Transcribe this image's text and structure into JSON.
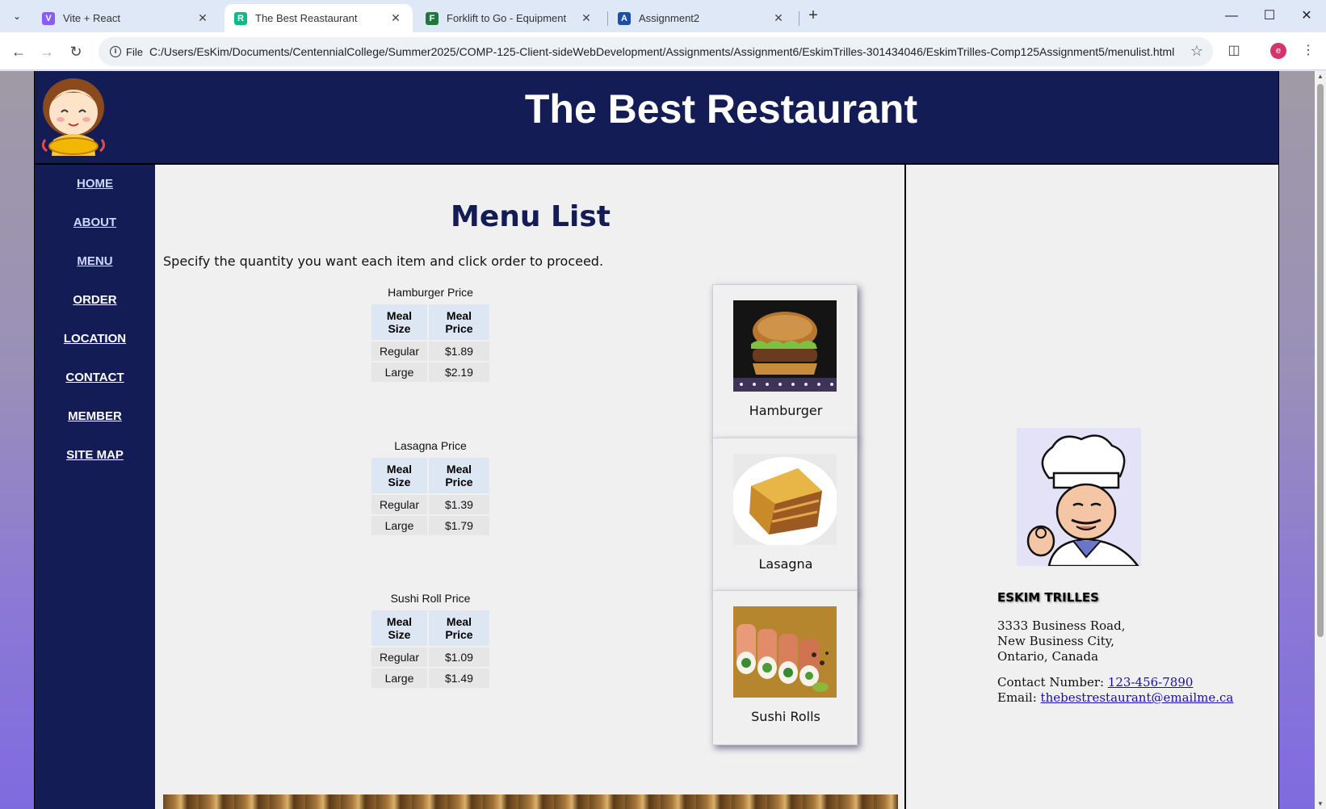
{
  "browser": {
    "tabs": [
      {
        "title": "Vite + React",
        "favicon_color": "#8a5cf6",
        "favicon_glyph": "V"
      },
      {
        "title": "The Best Reastaurant",
        "favicon_color": "#12b886",
        "favicon_glyph": "R"
      },
      {
        "title": "Forklift to Go - Equipment",
        "favicon_color": "#1e7a3c",
        "favicon_glyph": "F"
      },
      {
        "title": "Assignment2",
        "favicon_color": "#1c4fa8",
        "favicon_glyph": "A"
      }
    ],
    "omnibox": {
      "scheme_label": "File",
      "url": "C:/Users/EsKim/Documents/CentennialCollege/Summer2025/COMP-125-Client-sideWebDevelopment/Assignments/Assignment6/EskimTrilles-301434046/EskimTrilles-Comp125Assignment5/menulist.html"
    },
    "profile_initial": "e"
  },
  "site": {
    "title": "The Best Restaurant",
    "nav": [
      {
        "label": "HOME",
        "color": "#d0d8ff"
      },
      {
        "label": "ABOUT",
        "color": "#d0d8ff"
      },
      {
        "label": "MENU",
        "color": "#d0d8ff"
      },
      {
        "label": "ORDER",
        "color": "#ffffff"
      },
      {
        "label": "LOCATION",
        "color": "#ffffff"
      },
      {
        "label": "CONTACT",
        "color": "#ffffff"
      },
      {
        "label": "MEMBER",
        "color": "#ffffff"
      },
      {
        "label": "SITE MAP",
        "color": "#ffffff"
      }
    ]
  },
  "main": {
    "heading": "Menu List",
    "intro": "Specify the quantity you want each item and click order to proceed.",
    "table_headers": {
      "size": "Meal Size",
      "price": "Meal Price"
    },
    "items": [
      {
        "caption": "Hamburger Price",
        "name": "Hamburger",
        "rows": [
          {
            "size": "Regular",
            "price": "$1.89"
          },
          {
            "size": "Large",
            "price": "$2.19"
          }
        ]
      },
      {
        "caption": "Lasagna Price",
        "name": "Lasagna",
        "rows": [
          {
            "size": "Regular",
            "price": "$1.39"
          },
          {
            "size": "Large",
            "price": "$1.79"
          }
        ]
      },
      {
        "caption": "Sushi Roll Price",
        "name": "Sushi Rolls",
        "rows": [
          {
            "size": "Regular",
            "price": "$1.09"
          },
          {
            "size": "Large",
            "price": "$1.49"
          }
        ]
      }
    ]
  },
  "sidebar": {
    "owner": "ESKIM TRILLES",
    "address": [
      "3333 Business Road,",
      "New Business City,",
      "Ontario, Canada"
    ],
    "contact_label": "Contact Number:",
    "phone": "123-456-7890",
    "email_label": "Email:",
    "email": "thebestrestaurant@emailme.ca"
  }
}
